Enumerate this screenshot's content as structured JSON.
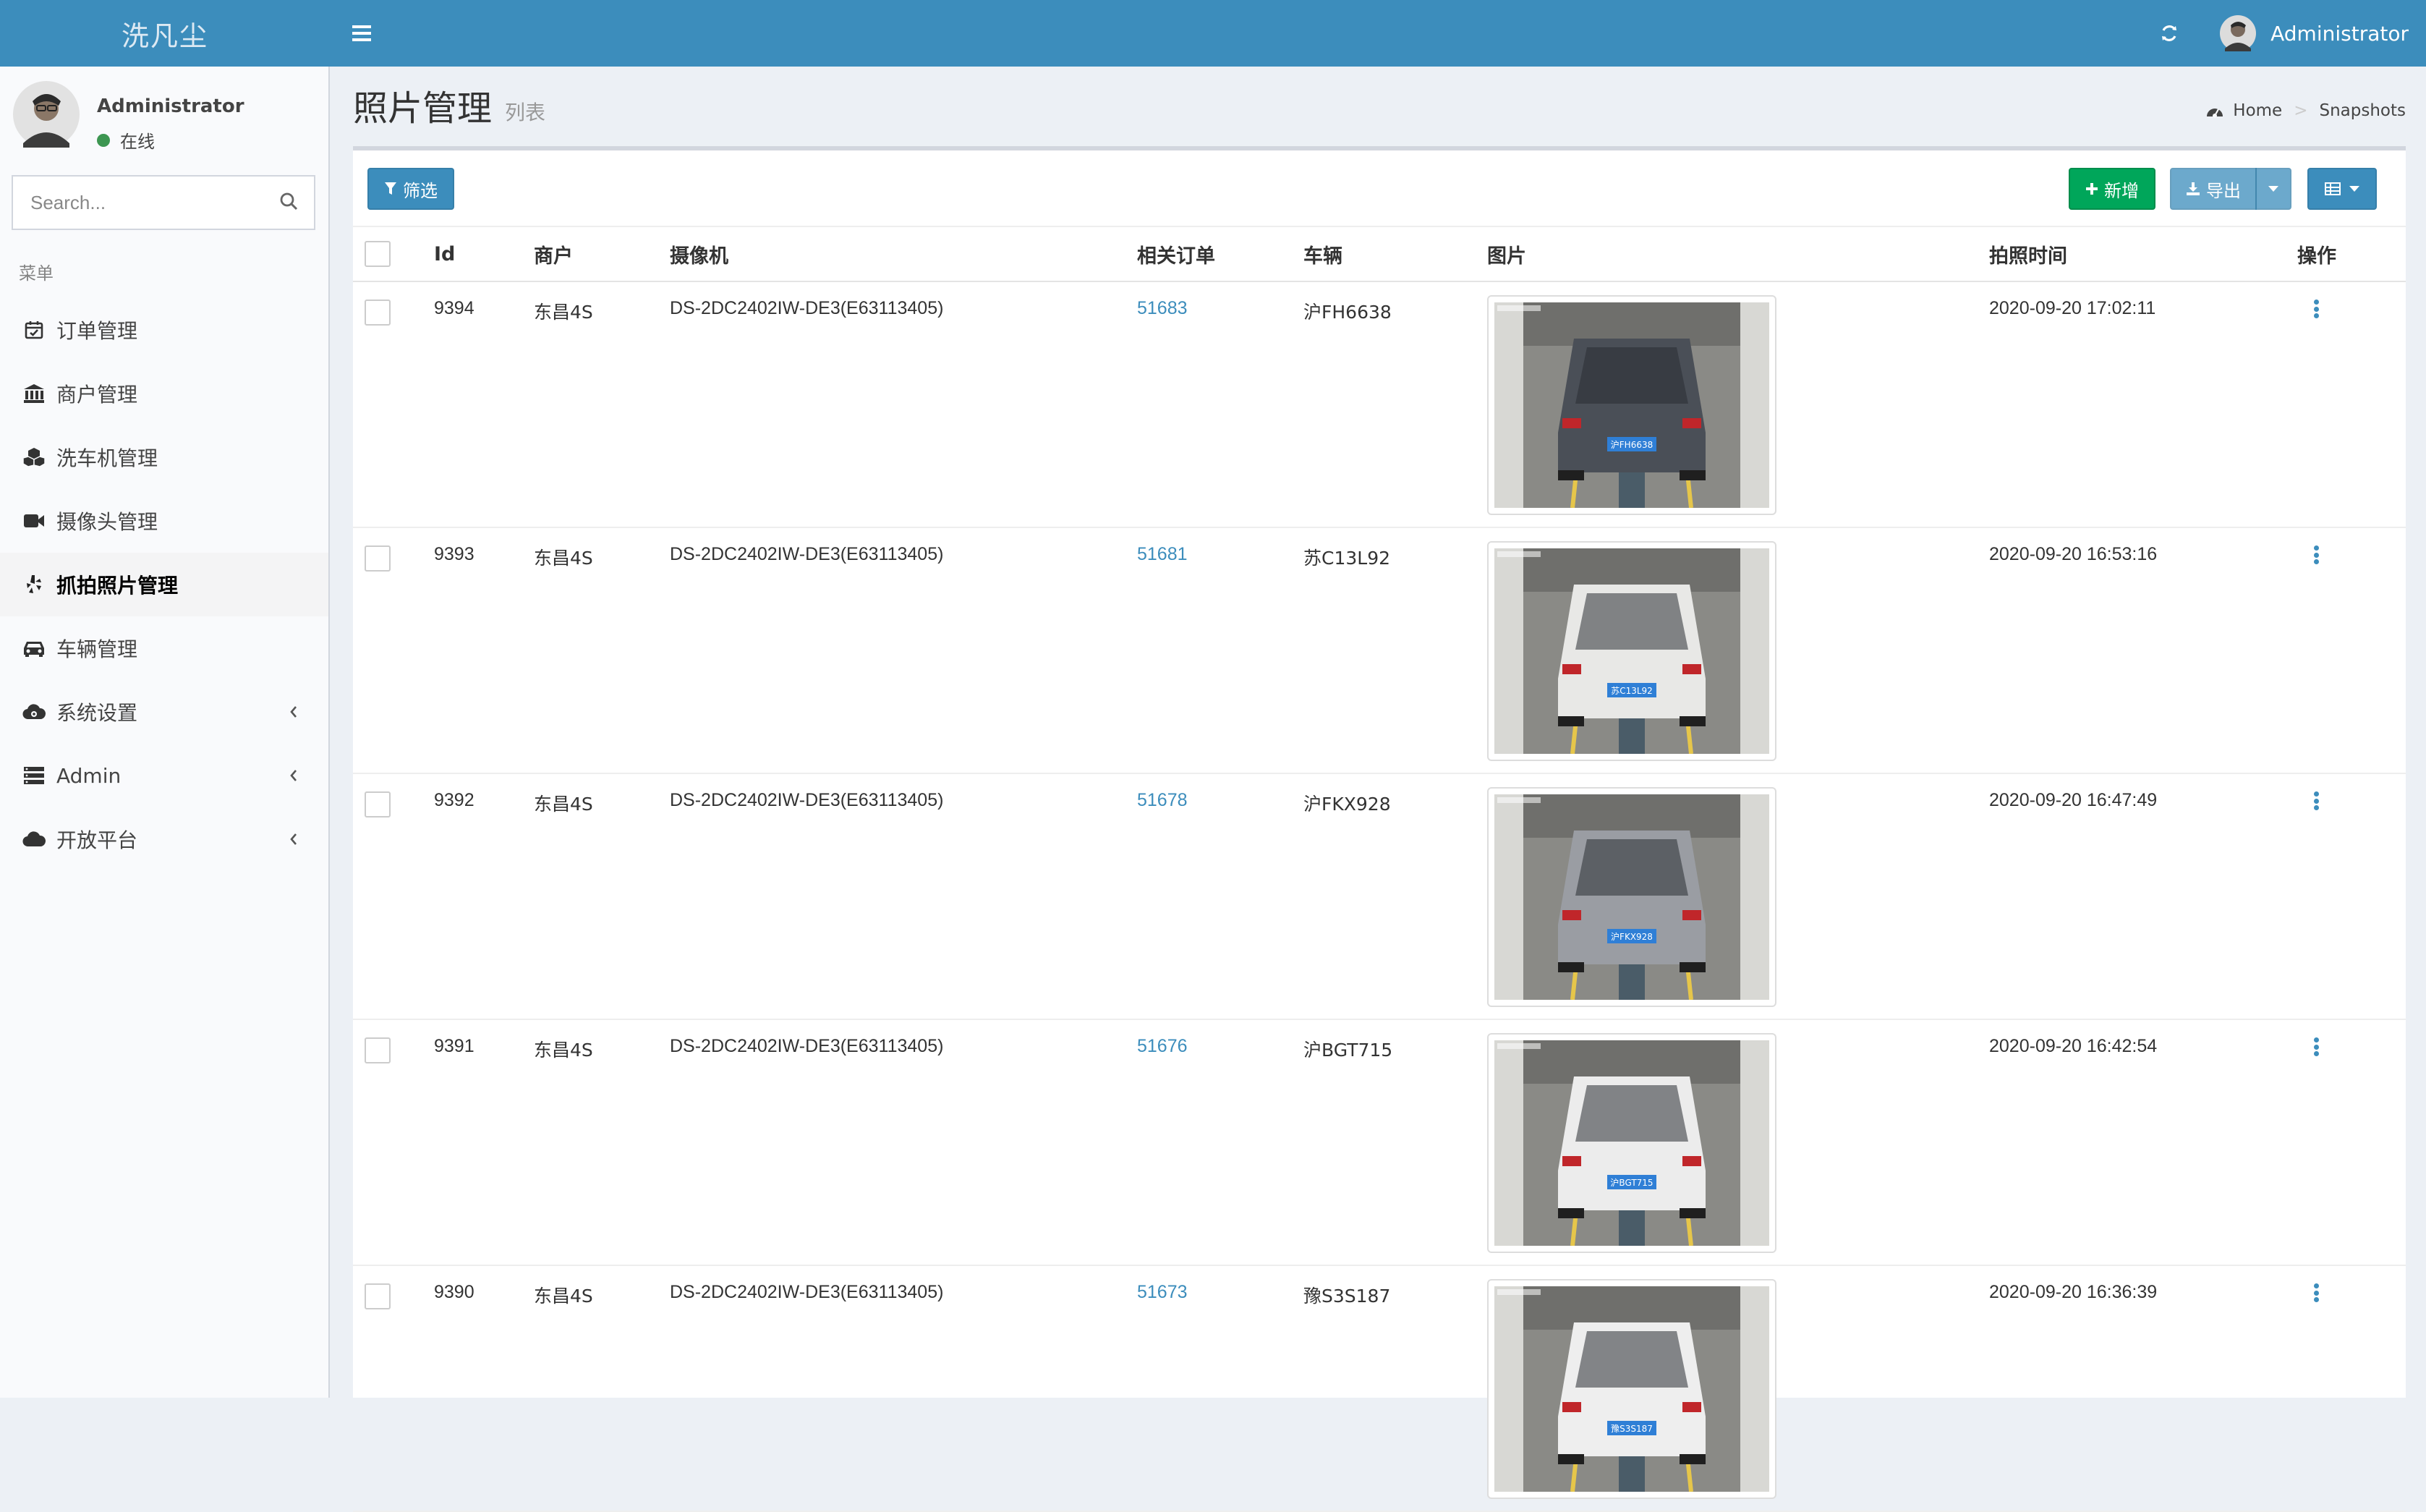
{
  "header": {
    "logo": "洗凡尘",
    "user_name": "Administrator"
  },
  "sidebar": {
    "user": {
      "name": "Administrator",
      "status": "在线"
    },
    "search_placeholder": "Search...",
    "menu_header": "菜单",
    "items": [
      {
        "label": "订单管理",
        "icon": "calendar-check-icon",
        "active": false,
        "has_submenu": false
      },
      {
        "label": "商户管理",
        "icon": "bank-icon",
        "active": false,
        "has_submenu": false
      },
      {
        "label": "洗车机管理",
        "icon": "cubes-icon",
        "active": false,
        "has_submenu": false
      },
      {
        "label": "摄像头管理",
        "icon": "video-camera-icon",
        "active": false,
        "has_submenu": false
      },
      {
        "label": "抓拍照片管理",
        "icon": "yelp-icon",
        "active": true,
        "has_submenu": false
      },
      {
        "label": "车辆管理",
        "icon": "car-icon",
        "active": false,
        "has_submenu": false
      },
      {
        "label": "系统设置",
        "icon": "cloud-settings-icon",
        "active": false,
        "has_submenu": true
      },
      {
        "label": "Admin",
        "icon": "server-icon",
        "active": false,
        "has_submenu": true
      },
      {
        "label": "开放平台",
        "icon": "cloud-icon",
        "active": false,
        "has_submenu": true
      }
    ]
  },
  "page": {
    "title": "照片管理",
    "subtitle": "列表",
    "breadcrumb": {
      "home": "Home",
      "current": "Snapshots"
    }
  },
  "toolbar": {
    "filter_label": "筛选",
    "new_label": "新增",
    "export_label": "导出"
  },
  "table": {
    "columns": [
      "Id",
      "商户",
      "摄像机",
      "相关订单",
      "车辆",
      "图片",
      "拍照时间",
      "操作"
    ],
    "rows": [
      {
        "id": "9394",
        "merchant": "东昌4S",
        "camera": "DS-2DC2402IW-DE3(E63113405)",
        "order": "51683",
        "vehicle": "沪FH6638",
        "time": "2020-09-20 17:02:11",
        "car_color": "#4a4f57",
        "plate": "沪FH6638"
      },
      {
        "id": "9393",
        "merchant": "东昌4S",
        "camera": "DS-2DC2402IW-DE3(E63113405)",
        "order": "51681",
        "vehicle": "苏C13L92",
        "time": "2020-09-20 16:53:16",
        "car_color": "#e8e8e6",
        "plate": "苏C13L92"
      },
      {
        "id": "9392",
        "merchant": "东昌4S",
        "camera": "DS-2DC2402IW-DE3(E63113405)",
        "order": "51678",
        "vehicle": "沪FKX928",
        "time": "2020-09-20 16:47:49",
        "car_color": "#9a9da3",
        "plate": "沪FKX928"
      },
      {
        "id": "9391",
        "merchant": "东昌4S",
        "camera": "DS-2DC2402IW-DE3(E63113405)",
        "order": "51676",
        "vehicle": "沪BGT715",
        "time": "2020-09-20 16:42:54",
        "car_color": "#ececec",
        "plate": "沪BGT715"
      },
      {
        "id": "9390",
        "merchant": "东昌4S",
        "camera": "DS-2DC2402IW-DE3(E63113405)",
        "order": "51673",
        "vehicle": "豫S3S187",
        "time": "2020-09-20 16:36:39",
        "car_color": "#eeeeee",
        "plate": "豫S3S187"
      }
    ]
  },
  "colors": {
    "header_bg": "#3c8dbc",
    "link": "#3c8dbc",
    "success": "#00a65a",
    "online": "#3d9651"
  }
}
